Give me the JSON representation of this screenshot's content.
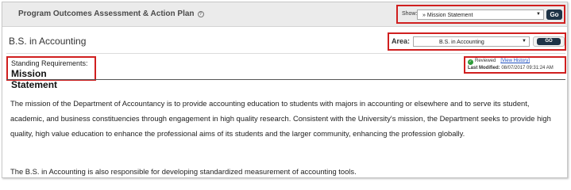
{
  "header": {
    "title": "Program Outcomes Assessment & Action Plan",
    "help_icon": "?",
    "show_label": "Show:",
    "show_value": "» Mission Statement",
    "go_label": "Go"
  },
  "program": {
    "name": "B.S. in Accounting",
    "area_label": "Area:",
    "area_value": "B.S. in Accounting",
    "go_label": "GO"
  },
  "requirement": {
    "label": "Standing Requirements:",
    "title": "Mission Statement"
  },
  "status": {
    "reviewed_label": "Reviewed",
    "view_history": "[View History]",
    "last_modified_label": "Last Modified:",
    "last_modified_value": "08/07/2017 09:31:24 AM"
  },
  "body": {
    "paragraph1": "The mission of the Department of Accountancy is to provide accounting education to students with majors in accounting or elsewhere and to serve its student, academic, and business constituencies through engagement in high quality research. Consistent with the University's mission, the Department seeks to provide high quality, high value education to enhance the professional aims of its students and the larger community, enhancing the profession globally.",
    "paragraph2": "The B.S. in Accounting is also responsible for developing standardized measurement of accounting tools."
  },
  "colors": {
    "highlight_border": "#d01f1f",
    "go_button": "#1e3346",
    "reviewed_check": "#2e9b3a",
    "link": "#1f4fbf"
  }
}
